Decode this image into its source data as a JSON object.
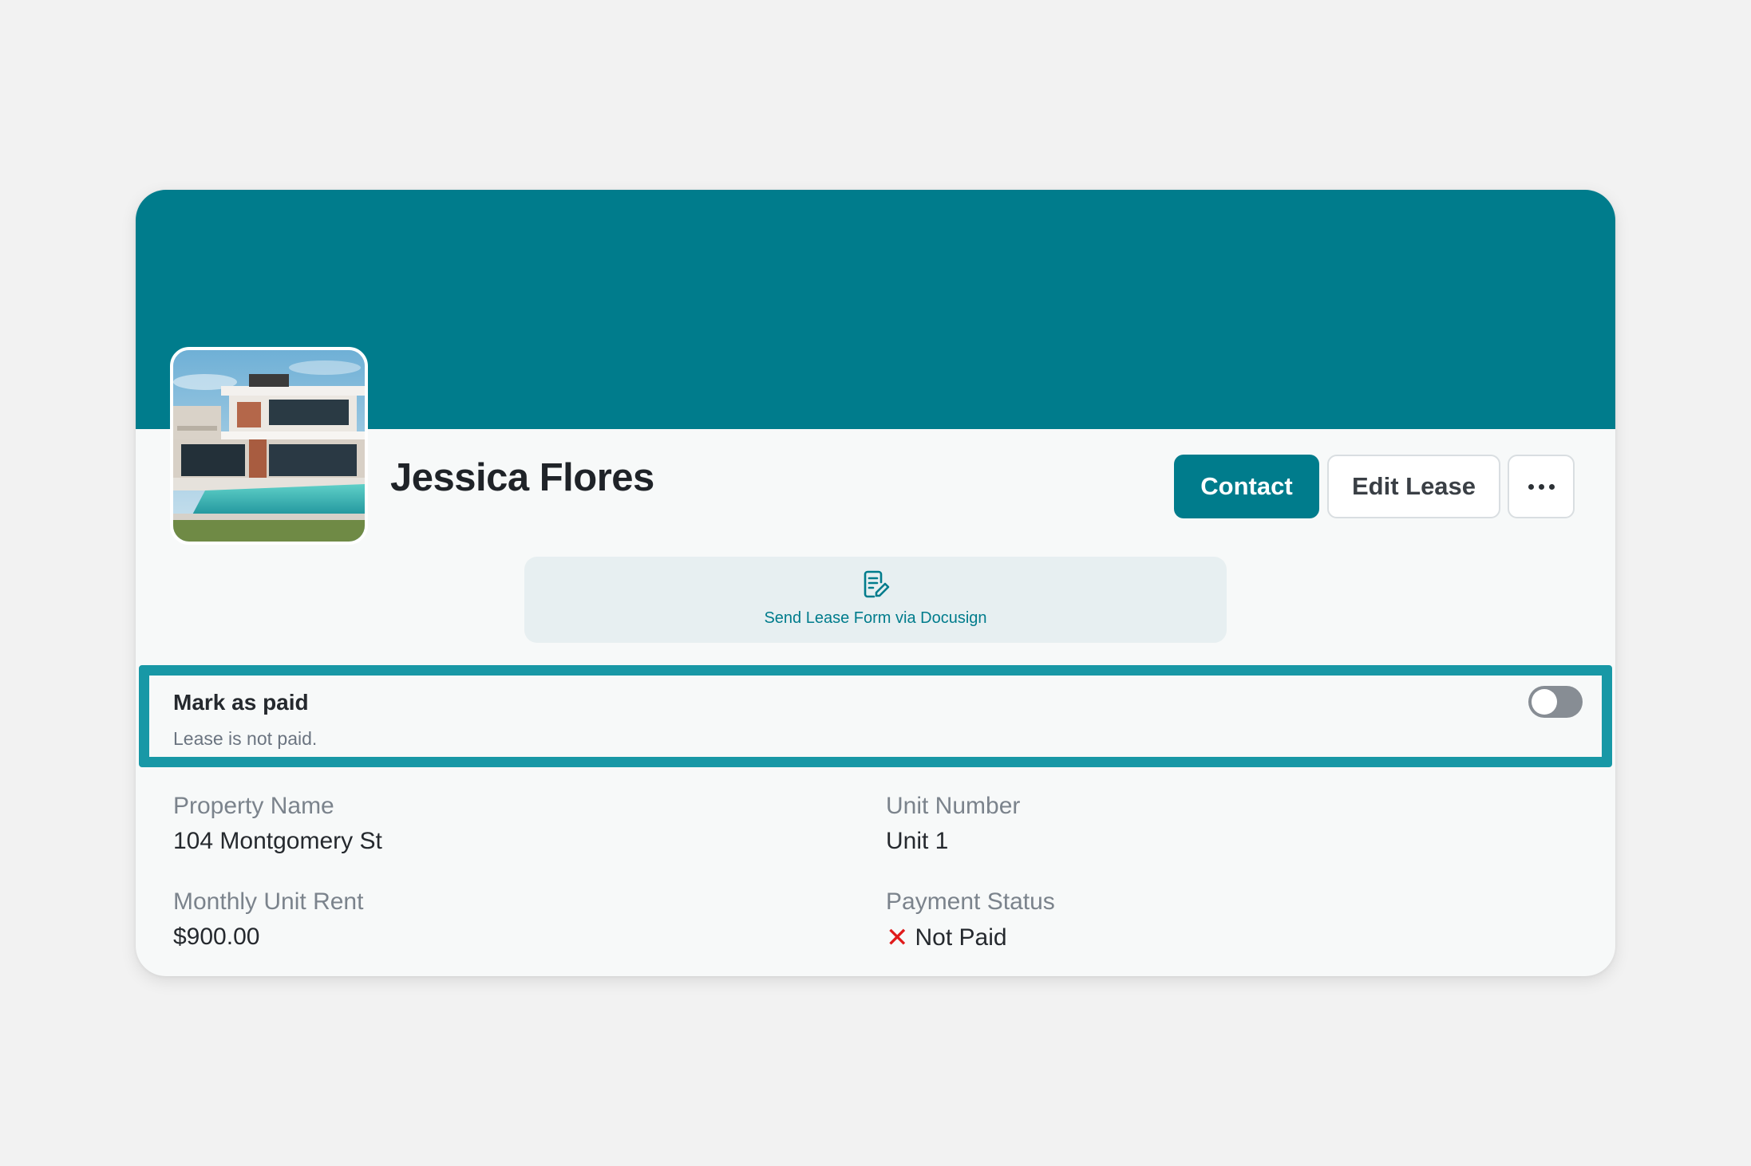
{
  "tenant": {
    "name": "Jessica Flores"
  },
  "actions": {
    "contact_label": "Contact",
    "edit_label": "Edit Lease",
    "more_icon": "ellipsis-icon"
  },
  "docusign": {
    "label": "Send Lease Form via Docusign",
    "icon": "document-edit-icon"
  },
  "paid_toggle": {
    "title": "Mark as paid",
    "subtitle": "Lease is not paid.",
    "checked": false
  },
  "details": {
    "property_name": {
      "label": "Property Name",
      "value": "104 Montgomery St"
    },
    "unit_number": {
      "label": "Unit Number",
      "value": "Unit 1"
    },
    "monthly_rent": {
      "label": "Monthly Unit Rent",
      "value": "$900.00"
    },
    "payment_status": {
      "label": "Payment Status",
      "value": "Not Paid",
      "icon": "x-mark-icon"
    }
  },
  "colors": {
    "brand": "#007c8c",
    "highlight_border": "#1898a6",
    "status_error": "#e01b1b"
  }
}
